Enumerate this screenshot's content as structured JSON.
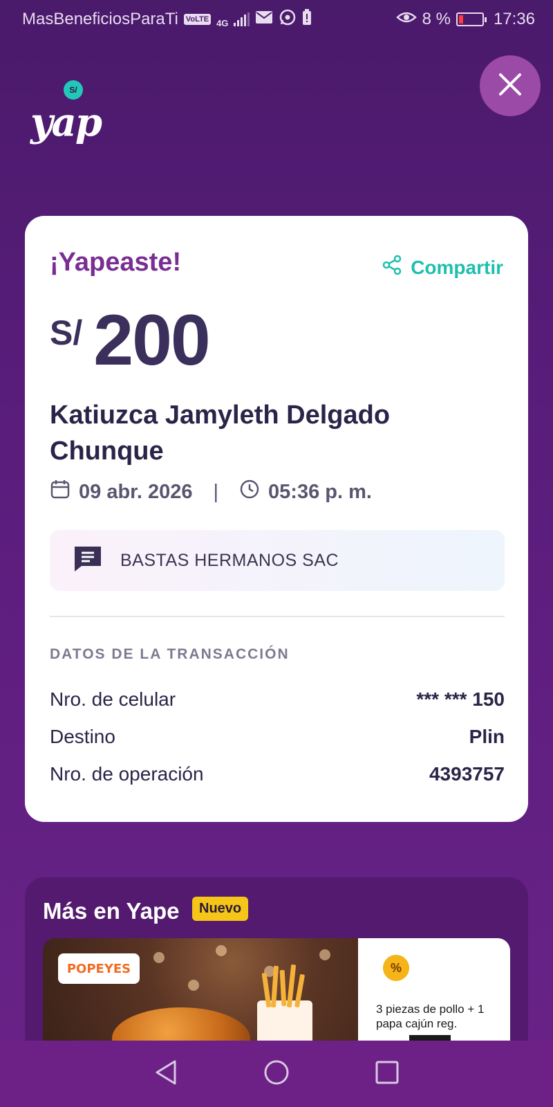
{
  "status_bar": {
    "carrier": "MasBeneficiosParaTi",
    "volte": "VoLTE",
    "network": "4G",
    "battery_percent": "8 %",
    "time": "17:36"
  },
  "logo": {
    "bubble": "S/",
    "text": "yap"
  },
  "receipt": {
    "title": "¡Yapeaste!",
    "share_label": "Compartir",
    "currency": "S/",
    "amount": "200",
    "recipient": "Katiuzca Jamyleth Delgado Chunque",
    "date": "09 abr. 2026",
    "separator": "|",
    "time": "05:36 p. m.",
    "merchant": "BASTAS HERMANOS SAC",
    "section_title": "DATOS DE LA TRANSACCIÓN",
    "rows": [
      {
        "label": "Nro. de celular",
        "value": "*** *** 150"
      },
      {
        "label": "Destino",
        "value": "Plin"
      },
      {
        "label": "Nro. de operación",
        "value": "4393757"
      }
    ]
  },
  "more": {
    "title": "Más en Yape",
    "badge": "Nuevo",
    "promo": {
      "brand": "POPEYES",
      "icon": "%",
      "text": "3 piezas de pollo + 1 papa cajún reg."
    }
  },
  "colors": {
    "background": "#4a1a6b",
    "accent_purple": "#7a2d92",
    "accent_teal": "#1fbfae",
    "badge_yellow": "#f5c518"
  }
}
